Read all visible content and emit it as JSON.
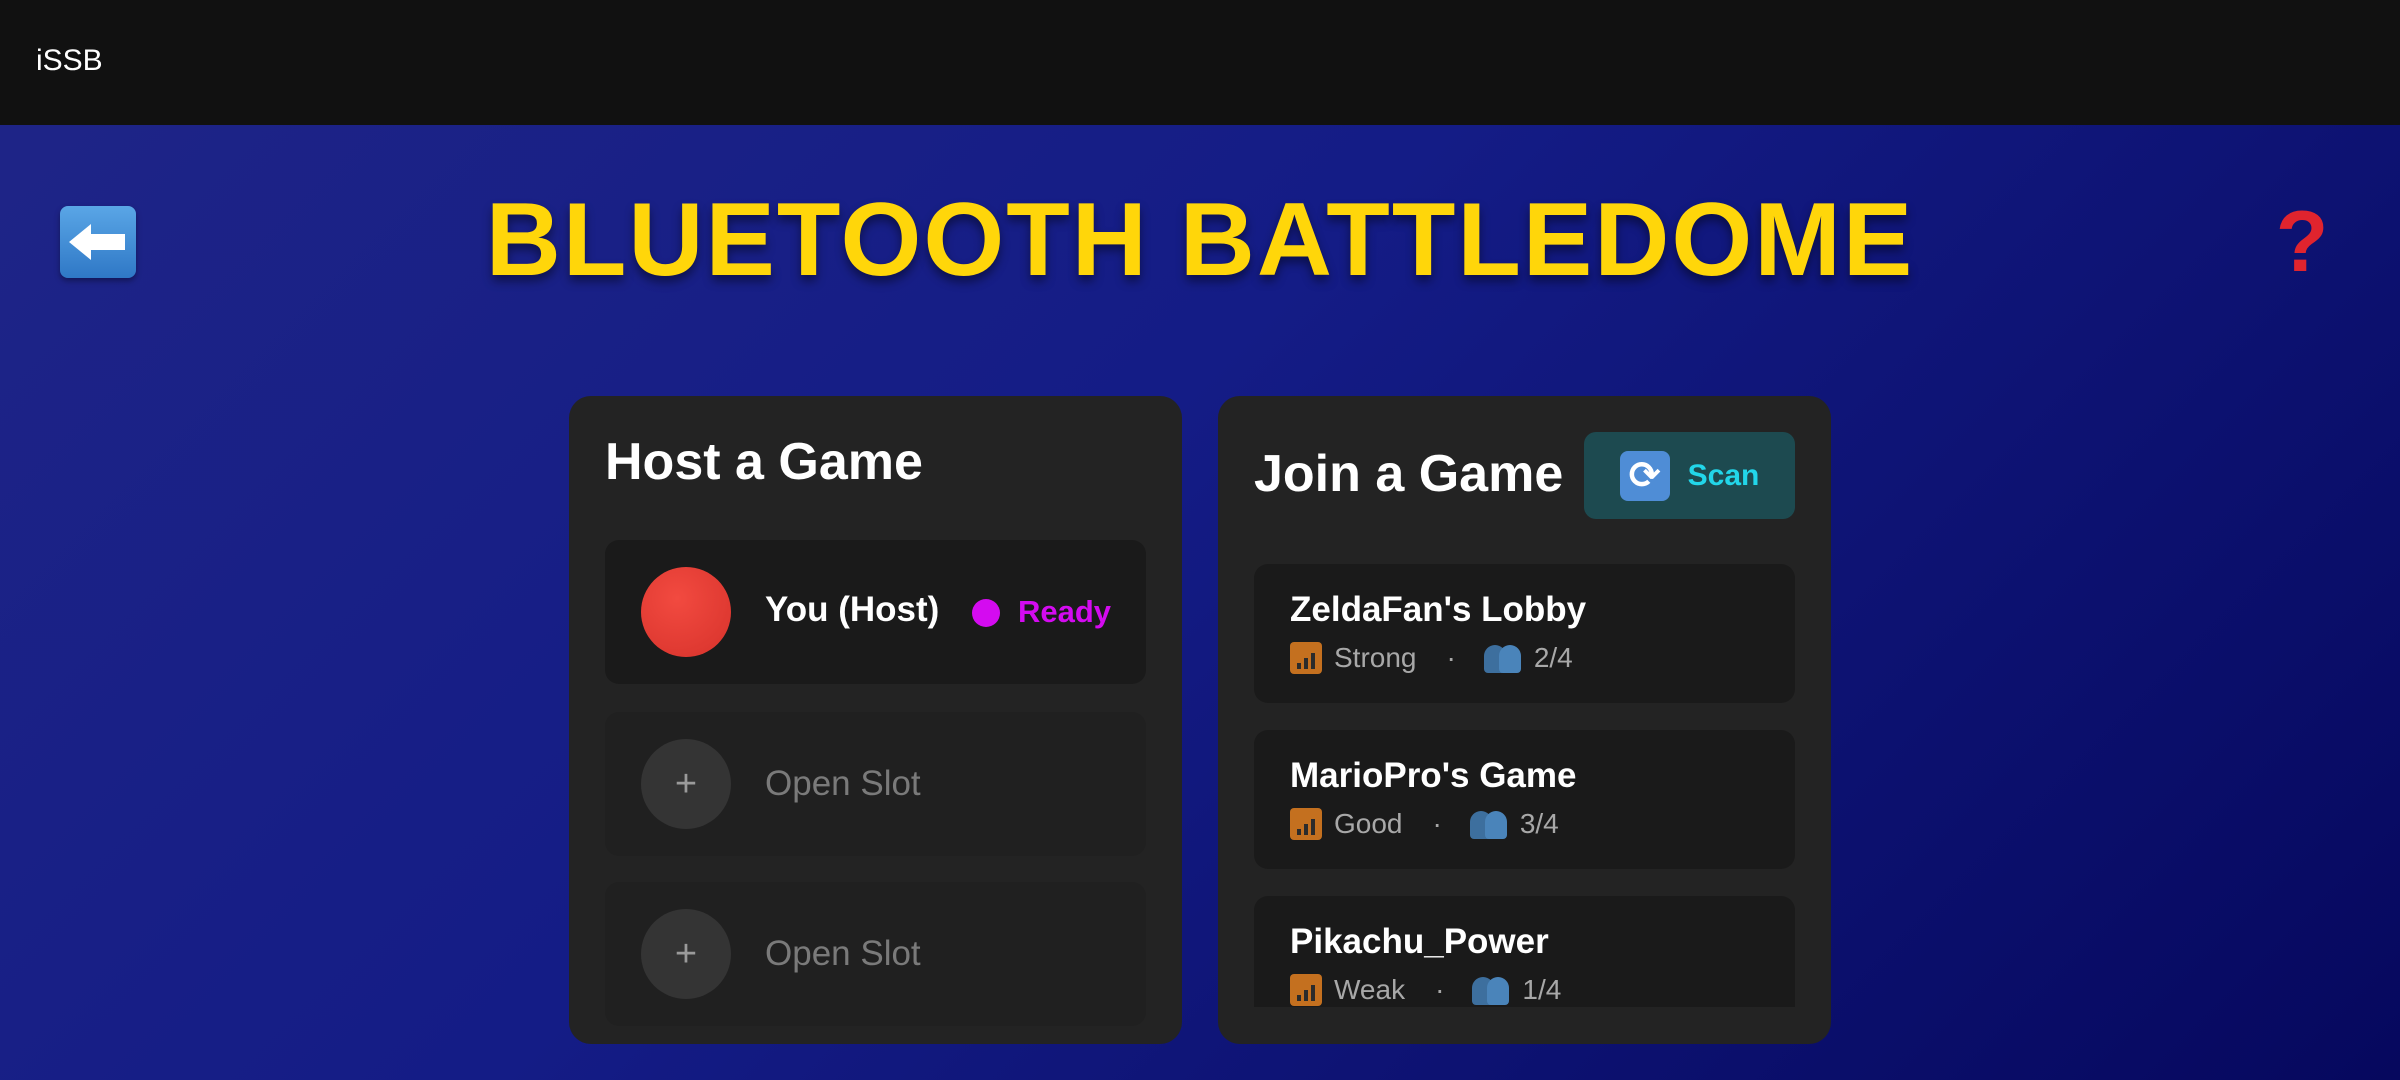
{
  "app": {
    "title": "iSSB"
  },
  "header": {
    "title": "BLUETOOTH BATTLEDOME"
  },
  "host": {
    "heading": "Host a Game",
    "player": {
      "name": "You (Host)",
      "status": "Ready",
      "status_color": "#d40bf0",
      "avatar_color": "#e23a33"
    },
    "open_slots": [
      {
        "icon": "+",
        "label": "Open Slot"
      },
      {
        "icon": "+",
        "label": "Open Slot"
      }
    ]
  },
  "join": {
    "heading": "Join a Game",
    "scan_label": "Scan",
    "scan_icon": "refresh-icon",
    "separator": "·",
    "lobbies": [
      {
        "name": "ZeldaFan's Lobby",
        "signal": "Strong",
        "players": "2/4"
      },
      {
        "name": "MarioPro's Game",
        "signal": "Good",
        "players": "3/4"
      },
      {
        "name": "Pikachu_Power",
        "signal": "Weak",
        "players": "1/4"
      }
    ]
  },
  "colors": {
    "title_yellow": "#ffd60a",
    "background_blue": "#141c86",
    "scan_text": "#22d6ea",
    "help_red": "#e0242e"
  },
  "icons": {
    "back": "back-arrow-icon",
    "help": "question-mark-icon",
    "signal": "signal-bars-icon",
    "players": "players-icon"
  }
}
